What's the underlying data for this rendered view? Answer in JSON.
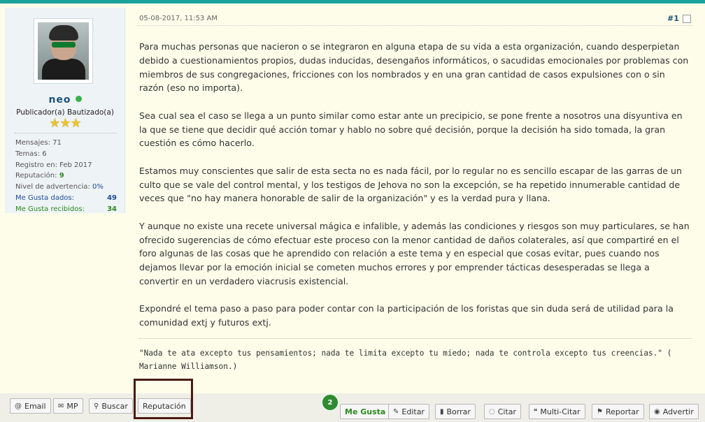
{
  "post": {
    "date": "05-08-2017, 11:53 AM",
    "number": "#1",
    "paragraphs": [
      "Para muchas personas que nacieron o se integraron en alguna etapa de su vida a esta organización, cuando desperpietan debido a cuestionamientos propios, dudas inducidas, desengaños informáticos, o sacudidas emocionales por problemas con miembros de sus congregaciones, fricciones con los nombrados y en una gran cantidad de casos expulsiones con o sin razón (eso no importa).",
      "Sea cual sea el caso se llega a un punto similar como estar ante un precipicio, se pone frente a nosotros una disyuntiva en la que se tiene que decidir qué acción tomar y hablo no sobre qué decisión, porque la decisión ha sido tomada, la gran cuestión es cómo hacerlo.",
      "Estamos muy conscientes que salir de esta secta no es nada fácil, por lo regular no es sencillo escapar de las garras de un culto que se vale del control mental, y los testigos de Jehova no son la excepción, se ha repetido innumerable cantidad de veces que \"no hay manera honorable de salir de la organización\" y es la verdad pura y llana.",
      "Y aunque no existe una recete universal mágica e infalible, y además las condiciones y riesgos son muy particulares, se han ofrecido sugerencias de cómo efectuar este proceso con la menor cantidad de daños colaterales, así que compartiré en el foro algunas de las cosas que he aprendido con relación a este tema y en especial que cosas evitar, pues cuando nos dejamos llevar por la emoción inicial se cometen muchos errores y por emprender tácticas desesperadas se llega a convertir en un verdadero viacrusis existencial.",
      "Expondré el tema paso a paso para poder contar con la participación de los foristas que sin duda será de utilidad para la comunidad extj y futuros extj."
    ],
    "signature": "\"Nada te ata excepto tus pensamientos; nada te limita excepto tu miedo; nada te controla excepto tus creencias.\" ( Marianne Williamson.)"
  },
  "user": {
    "name": "neo",
    "title": "Publicador(a) Bautizado(a)",
    "stars": "★★★",
    "stats": {
      "mensajes": "Mensajes: 71",
      "temas": "Temas: 6",
      "registro": "Registro en: Feb 2017",
      "reputacion_label": "Reputación:",
      "reputacion_value": "9",
      "advertencia_label": "Nivel de advertencia:",
      "advertencia_value": "0%",
      "me_gusta_dados_label": "Me Gusta dados:",
      "me_gusta_dados_value": "49",
      "me_gusta_recibidos_label": "Me Gusta recibidos:",
      "me_gusta_recibidos_value": "34"
    }
  },
  "footer": {
    "left_buttons": {
      "email": "Email",
      "mp": "MP",
      "buscar": "Buscar",
      "reputacion": "Reputación"
    },
    "like_count": "2",
    "right_buttons": {
      "me_gusta": "Me Gusta",
      "editar": "Editar",
      "borrar": "Borrar",
      "citar": "Citar",
      "multi_citar": "Multi-Citar",
      "reportar": "Reportar",
      "advertir": "Advertir"
    }
  },
  "colors": {
    "accent": "#1aa39a",
    "highlight_border": "#4a1b12",
    "like_green": "#2f8b30"
  }
}
